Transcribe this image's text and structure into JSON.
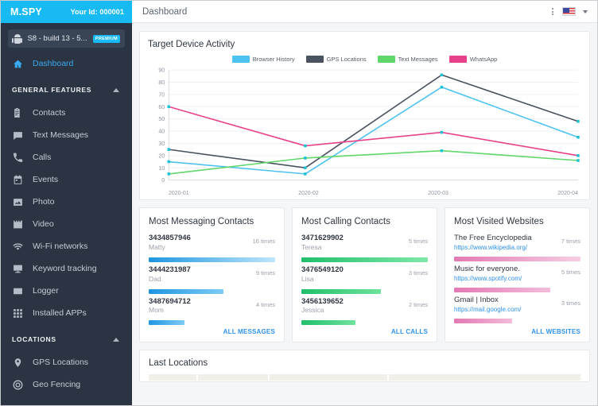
{
  "brand": {
    "logo_text": "M.SPY",
    "your_id": "Your Id: 000001"
  },
  "header": {
    "title": "Dashboard",
    "menu_icon": "kebab-menu-icon",
    "flag": "us-flag-icon",
    "caret": "chevron-down-icon"
  },
  "sidebar": {
    "device": {
      "name": "S8 - build 13 - 5...",
      "badge": "PREMIUM",
      "icon": "android-icon"
    },
    "dashboard": {
      "label": "Dashboard",
      "icon": "home-icon"
    },
    "general_features": {
      "label": "GENERAL FEATURES",
      "collapse_icon": "chevron-up-icon"
    },
    "items": [
      {
        "label": "Contacts",
        "icon": "contacts-icon"
      },
      {
        "label": "Text Messages",
        "icon": "message-icon"
      },
      {
        "label": "Calls",
        "icon": "phone-icon"
      },
      {
        "label": "Events",
        "icon": "calendar-icon"
      },
      {
        "label": "Photo",
        "icon": "photo-icon"
      },
      {
        "label": "Video",
        "icon": "video-icon"
      },
      {
        "label": "Wi-Fi networks",
        "icon": "wifi-icon"
      },
      {
        "label": "Keyword tracking",
        "icon": "monitor-icon"
      },
      {
        "label": "Logger",
        "icon": "logger-icon"
      },
      {
        "label": "Installed APPs",
        "icon": "grid-apps-icon"
      }
    ],
    "locations": {
      "label": "LOCATIONS",
      "collapse_icon": "chevron-up-icon"
    },
    "location_items": [
      {
        "label": "GPS Locations",
        "icon": "map-pin-icon"
      },
      {
        "label": "Geo Fencing",
        "icon": "target-icon"
      }
    ]
  },
  "chart_data": {
    "type": "line",
    "title": "Target Device Activity",
    "categories": [
      "2020-01",
      "2020-02",
      "2020-03",
      "2020-04"
    ],
    "series": [
      {
        "name": "Browser History",
        "color": "#4cc2f1",
        "values": [
          15,
          5,
          76,
          35
        ]
      },
      {
        "name": "GPS Locations",
        "color": "#4a5260",
        "values": [
          25,
          10,
          86,
          48
        ]
      },
      {
        "name": "Text Messages",
        "color": "#61d66a",
        "values": [
          5,
          18,
          24,
          16
        ]
      },
      {
        "name": "WhatsApp",
        "color": "#e8418b",
        "values": [
          60,
          28,
          39,
          20
        ]
      }
    ],
    "yticks": [
      0,
      10,
      20,
      30,
      40,
      50,
      60,
      70,
      80,
      90
    ],
    "ylim": [
      0,
      90
    ],
    "xlabel": "",
    "ylabel": "",
    "grid": true,
    "legend_position": "top-center",
    "point_color": "#17c3d4"
  },
  "messaging": {
    "title": "Most Messaging Contacts",
    "all_label": "ALL MESSAGES",
    "bar_from": "#1e96e0",
    "bar_to": "#b9e4fb",
    "rows": [
      {
        "number": "3434857946",
        "name": "Matty",
        "count": "16 times",
        "pct": 100
      },
      {
        "number": "3444231987",
        "name": "Dad",
        "count": "9 times",
        "pct": 59
      },
      {
        "number": "3487694712",
        "name": "Mom",
        "count": "4 times",
        "pct": 28
      }
    ]
  },
  "calling": {
    "title": "Most Calling Contacts",
    "all_label": "ALL CALLS",
    "bar_from": "#1fc islands",
    "rows": [
      {
        "number": "3471629902",
        "name": "Teresa",
        "count": "5 times",
        "pct": 100
      },
      {
        "number": "3476549120",
        "name": "Lisa",
        "count": "3 times",
        "pct": 63
      },
      {
        "number": "3456139652",
        "name": "Jessica",
        "count": "2 times",
        "pct": 43
      }
    ]
  },
  "websites": {
    "title": "Most Visited Websites",
    "all_label": "ALL WEBSITES",
    "rows": [
      {
        "name": "The Free Encyclopedia",
        "url": "https://www.wikipedia.org/",
        "count": "7 times",
        "pct": 100
      },
      {
        "name": "Music for everyone.",
        "url": "https://www.spotify.com/",
        "count": "5 times",
        "pct": 76
      },
      {
        "name": "Gmail | Inbox",
        "url": "https://mail.google.com/",
        "count": "3 times",
        "pct": 46
      }
    ]
  },
  "last_locations": {
    "title": "Last Locations"
  }
}
